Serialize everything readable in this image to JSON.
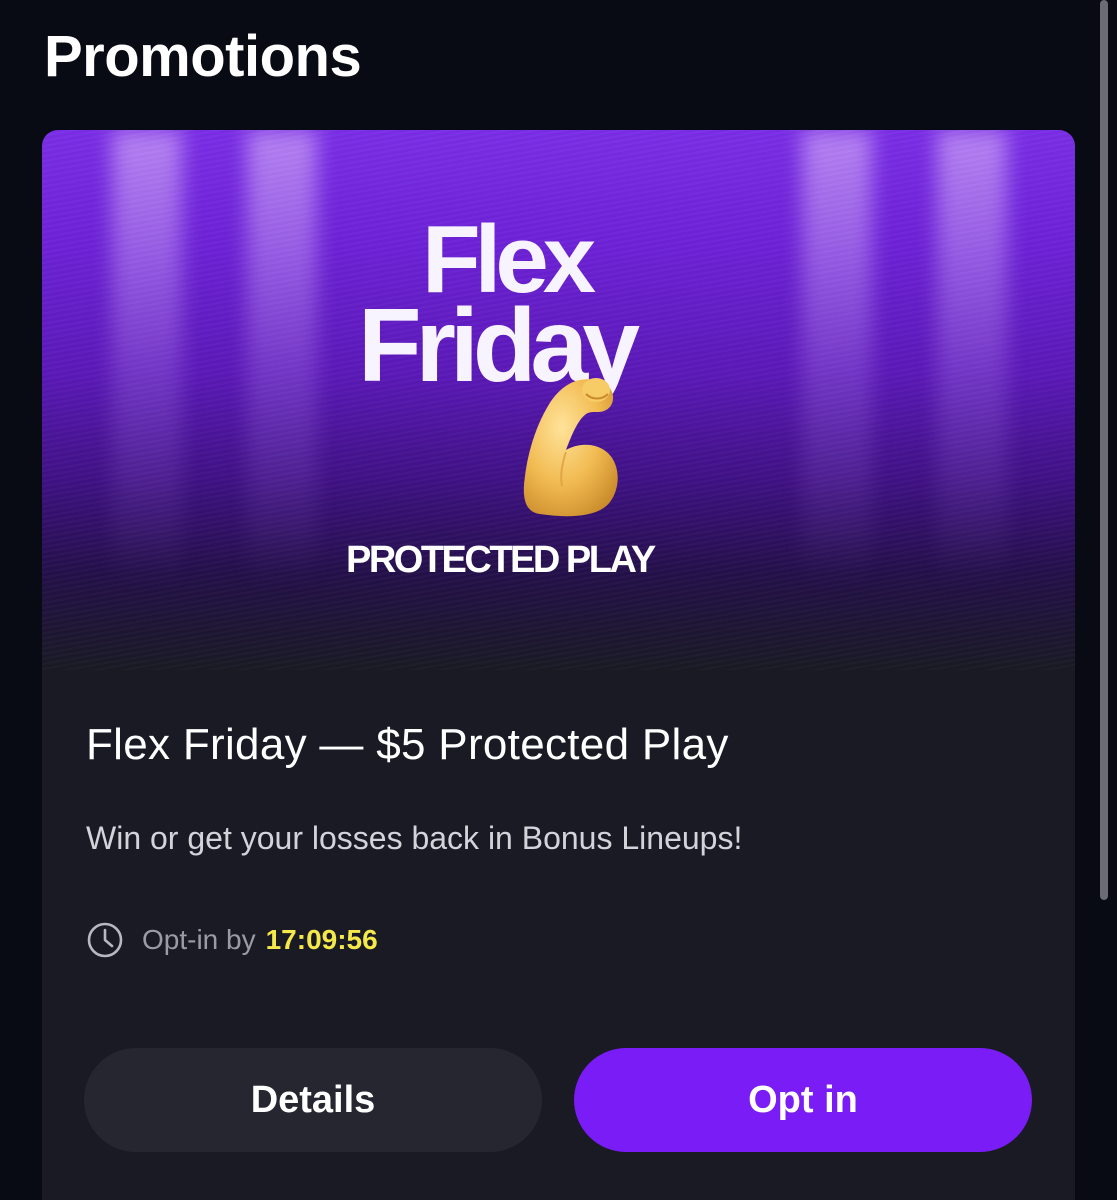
{
  "page": {
    "title": "Promotions"
  },
  "promotion": {
    "banner": {
      "logo_line1": "Flex",
      "logo_line2": "Friday",
      "subtitle": "PROTECTED PLAY",
      "icon": "flexed-biceps-icon"
    },
    "title": "Flex Friday — $5 Protected Play",
    "description": "Win or get your losses back in Bonus Lineups!",
    "deadline_label": "Opt-in by",
    "deadline_time": "17:09:56",
    "deadline_icon": "clock-icon",
    "details_label": "Details",
    "optin_label": "Opt in"
  },
  "colors": {
    "background": "#080a14",
    "card": "#191a24",
    "accent_purple": "#7a1cf5",
    "countdown_yellow": "#f4e84a",
    "secondary_button": "#252630"
  }
}
